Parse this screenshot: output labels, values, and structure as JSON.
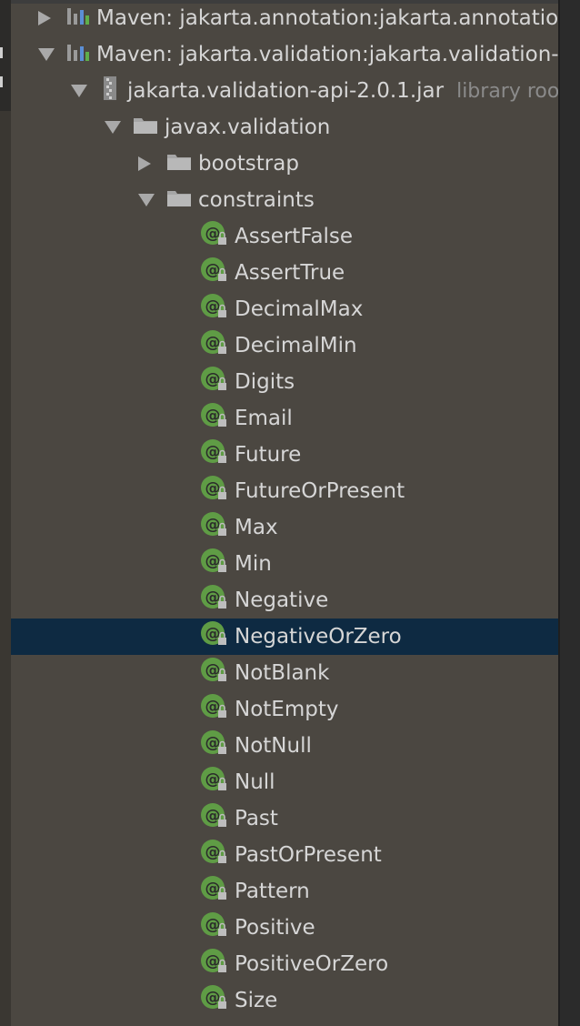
{
  "tree": {
    "rows": [
      {
        "label": "Maven: jakarta.annotation:jakarta.annotation-api",
        "icon": "maven-library-icon",
        "expanded": false
      },
      {
        "label": "Maven: jakarta.validation:jakarta.validation-api",
        "icon": "maven-library-icon",
        "expanded": true
      },
      {
        "label": "jakarta.validation-api-2.0.1.jar",
        "suffix": "library root",
        "icon": "jar-icon",
        "expanded": true
      },
      {
        "label": "javax.validation",
        "icon": "package-icon",
        "expanded": true
      },
      {
        "label": "bootstrap",
        "icon": "package-icon",
        "expanded": false
      },
      {
        "label": "constraints",
        "icon": "package-icon",
        "expanded": true
      }
    ],
    "annotations": [
      "AssertFalse",
      "AssertTrue",
      "DecimalMax",
      "DecimalMin",
      "Digits",
      "Email",
      "Future",
      "FutureOrPresent",
      "Max",
      "Min",
      "Negative",
      "NegativeOrZero",
      "NotBlank",
      "NotEmpty",
      "NotNull",
      "Null",
      "Past",
      "PastOrPresent",
      "Pattern",
      "Positive",
      "PositiveOrZero",
      "Size"
    ],
    "selected": "NegativeOrZero",
    "annotation_icon": "annotation-class-icon"
  },
  "colors": {
    "background": "#4b4741",
    "selection": "#0e2a42",
    "text": "#d6d6d6",
    "annotation_icon_green": "#5f9c45"
  }
}
